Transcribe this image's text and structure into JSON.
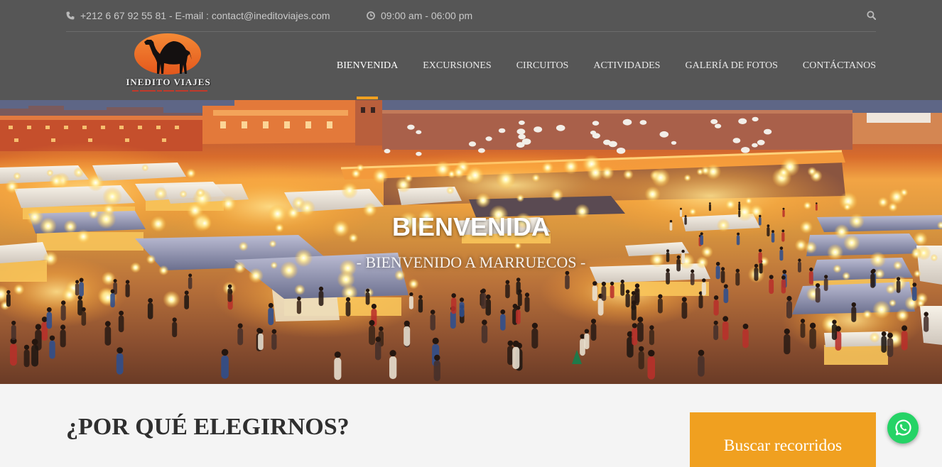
{
  "topbar": {
    "phone_icon": "phone-icon",
    "contact": "+212 6 67 92 55 81 - E-mail : contact@ineditoviajes.com",
    "clock_icon": "clock-icon",
    "hours": "09:00 am - 06:00 pm",
    "search_icon": "search-icon"
  },
  "logo": {
    "name": "INEDITO VIAJES",
    "icon": "camel-icon"
  },
  "nav": {
    "items": [
      {
        "label": "BIENVENIDA",
        "active": true
      },
      {
        "label": "EXCURSIONES",
        "active": false
      },
      {
        "label": "CIRCUITOS",
        "active": false
      },
      {
        "label": "ACTIVIDADES",
        "active": false
      },
      {
        "label": "GALERÍA DE FOTOS",
        "active": false
      },
      {
        "label": "CONTÁCTANOS",
        "active": false
      }
    ]
  },
  "hero": {
    "title": "BIENVENIDA",
    "subtitle": "- BIENVENIDO A MARRUECOS -"
  },
  "why_us": {
    "heading": "¿POR QUÉ ELEGIRNOS?"
  },
  "search_panel": {
    "title": "Buscar recorridos"
  },
  "whatsapp": {
    "icon": "whatsapp-icon"
  },
  "colors": {
    "header_bg": "#565656",
    "accent": "#f0a020",
    "section_bg": "#f4f4f4",
    "whatsapp_green": "#25d366"
  }
}
